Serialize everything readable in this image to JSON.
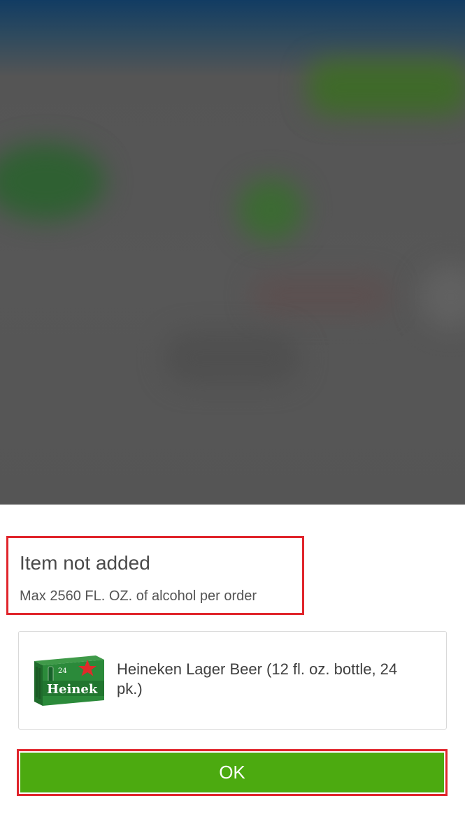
{
  "dialog": {
    "title": "Item not added",
    "message": "Max 2560 FL. OZ. of alcohol per order",
    "product": {
      "name": "Heineken Lager Beer (12 fl. oz. bottle, 24 pk.)",
      "image_brand_text": "Heinek",
      "image_pack_count": "24",
      "image_icon": "beer-case-product-image"
    },
    "ok_label": "OK"
  },
  "colors": {
    "accent_green": "#4caa10",
    "highlight_red": "#e0242b",
    "sheet_background": "#ffffff",
    "backdrop_dim": "#555555"
  }
}
